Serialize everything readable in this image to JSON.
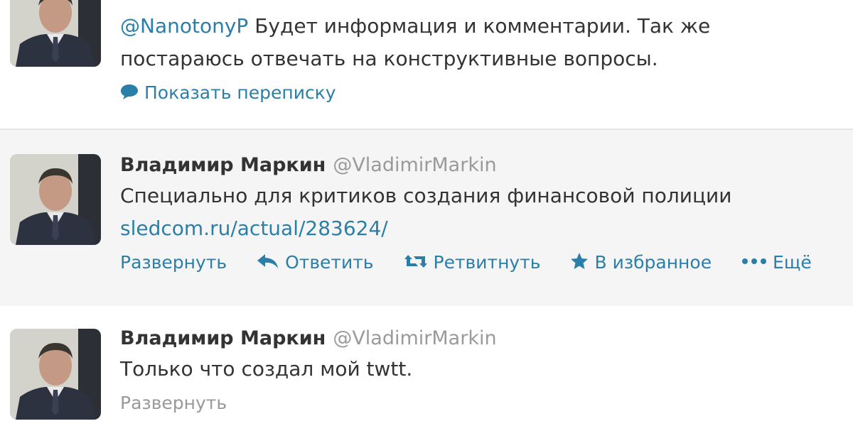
{
  "tweets": [
    {
      "mention": "@NanotonyP",
      "text_after_mention": " Будет информация и комментарии. Так же",
      "text_line2": "постараюсь отвечать на конструктивные вопросы.",
      "action_label": "Показать переписку",
      "action_icon": "speech-bubble-icon"
    },
    {
      "name": "Владимир Маркин",
      "handle": "@VladimirMarkin",
      "text": "Специально для критиков создания финансовой полиции",
      "link": "sledcom.ru/actual/283624/",
      "actions": {
        "expand": "Развернуть",
        "reply": "Ответить",
        "retweet": "Ретвитнуть",
        "favorite": "В избранное",
        "more": "Ещё"
      },
      "icons": [
        "reply-icon",
        "retweet-icon",
        "star-icon",
        "more-dots-icon"
      ],
      "accent": "#2a7fa9",
      "background": "#f5f5f5"
    },
    {
      "name": "Владимир Маркин",
      "handle": "@VladimirMarkin",
      "text": "Только что создал мой twtt.",
      "actions": {
        "expand": "Развернуть"
      }
    }
  ]
}
